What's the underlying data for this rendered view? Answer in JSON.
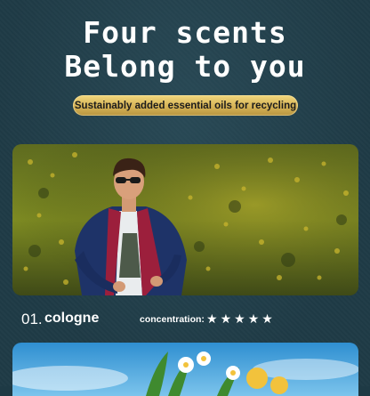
{
  "headline": {
    "line1": "Four scents",
    "line2": "Belong to you"
  },
  "badge": {
    "text": "Sustainably added essential oils for recycling"
  },
  "products": [
    {
      "number": "01.",
      "name": "cologne",
      "concentration_label": "concentration:",
      "rating": 5,
      "rating_max": 5
    }
  ],
  "colors": {
    "background": "#1f3b46",
    "badge_gold": "#d6b356",
    "text": "#ffffff"
  }
}
